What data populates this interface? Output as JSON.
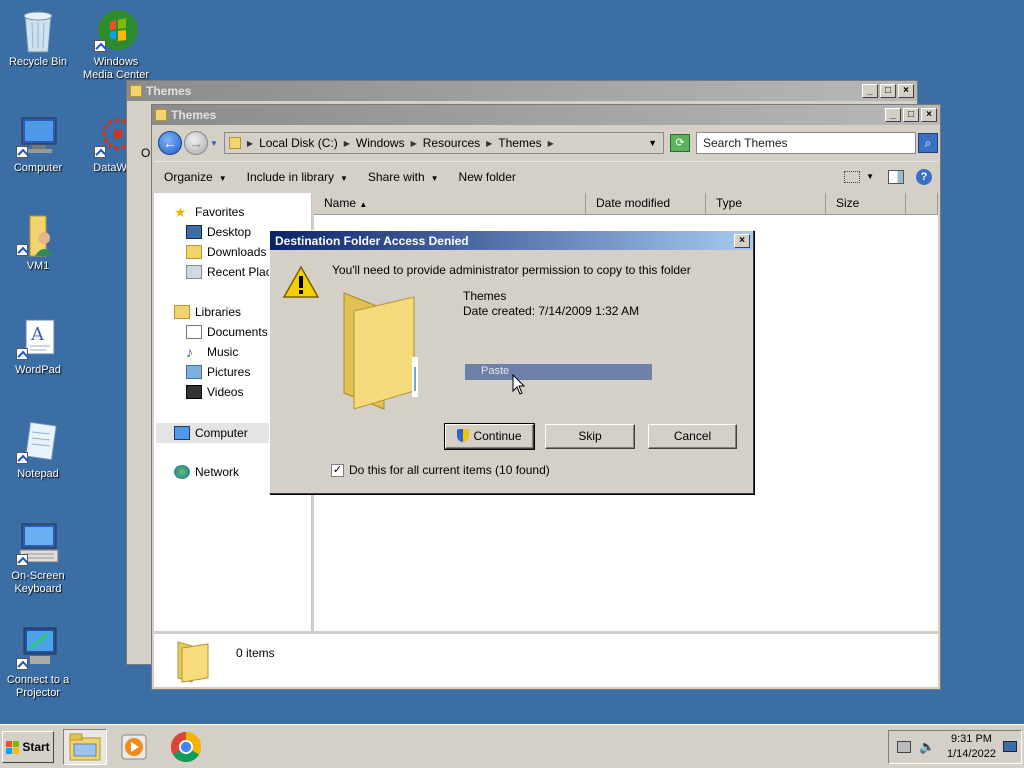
{
  "desktop": {
    "icons": [
      {
        "label": "Recycle Bin"
      },
      {
        "label": "Windows Media Center"
      },
      {
        "label": "Computer"
      },
      {
        "label": "DataWag"
      },
      {
        "label": "VM1"
      },
      {
        "label": "WordPad"
      },
      {
        "label": "Notepad"
      },
      {
        "label": "On-Screen Keyboard"
      },
      {
        "label": "Connect to a Projector"
      }
    ]
  },
  "back_window": {
    "title": "Themes",
    "partial_text": "O"
  },
  "explorer": {
    "title": "Themes",
    "breadcrumbs": [
      "Local Disk (C:)",
      "Windows",
      "Resources",
      "Themes"
    ],
    "search_placeholder": "Search Themes",
    "commands": [
      "Organize",
      "Include in library",
      "Share with",
      "New folder"
    ],
    "nav": {
      "favorites": "Favorites",
      "desktop": "Desktop",
      "downloads": "Downloads",
      "recent": "Recent Places",
      "libraries": "Libraries",
      "documents": "Documents",
      "music": "Music",
      "pictures": "Pictures",
      "videos": "Videos",
      "computer": "Computer",
      "network": "Network"
    },
    "columns": [
      "Name",
      "Date modified",
      "Type",
      "Size"
    ],
    "status": "0 items"
  },
  "dialog": {
    "title": "Destination Folder Access Denied",
    "message": "You'll need to provide administrator permission to copy to this folder",
    "folder_name": "Themes",
    "date_created": "Date created: 7/14/2009 1:32 AM",
    "progress_label": "Paste",
    "buttons": {
      "continue": "Continue",
      "skip": "Skip",
      "cancel": "Cancel"
    },
    "checkbox_label": "Do this for all current items (10 found)",
    "checkbox_checked": true
  },
  "taskbar": {
    "start": "Start",
    "time": "9:31 PM",
    "date": "1/14/2022"
  },
  "colors": {
    "desktop_bg": "#3a6ea5",
    "active_title": "#0a246a",
    "progress": "#6e7fa8"
  }
}
